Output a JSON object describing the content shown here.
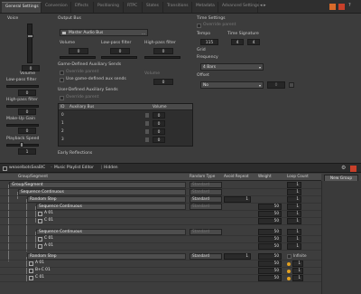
{
  "tabs": [
    "General Settings",
    "Conversion",
    "Effects",
    "Positioning",
    "RTPC",
    "States",
    "Transitions",
    "Metadata",
    "Advanced Settings"
  ],
  "voice": {
    "title": "Voice",
    "volume_label": "Volume",
    "volume_value": "0",
    "lowpass_label": "Low-pass filter",
    "lowpass_value": "0",
    "highpass_label": "High-pass filter",
    "highpass_value": "0",
    "makeup_label": "Make-Up Gain",
    "makeup_value": "0",
    "playback_label": "Playback Speed",
    "playback_value": "1"
  },
  "output_bus": {
    "title": "Output Bus",
    "bus_name": "Master Audio Bus",
    "volume_label": "Volume",
    "volume_value": "0",
    "lowpass_label": "Low-pass filter",
    "lowpass_value": "0",
    "highpass_label": "High-pass filter",
    "highpass_value": "0"
  },
  "game_sends": {
    "title": "Game-Defined Auxiliary Sends",
    "override_label": "Override parent",
    "volume_label": "Volume",
    "use_game_label": "Use game-defined aux sends",
    "value": "0"
  },
  "user_sends": {
    "title": "User-Defined Auxiliary Sends",
    "override_label": "Override parent",
    "headers": [
      "ID",
      "Auxiliary Bus",
      "Volume"
    ],
    "rows": [
      {
        "id": "0",
        "bus": "",
        "vol": "0"
      },
      {
        "id": "1",
        "bus": "",
        "vol": "0"
      },
      {
        "id": "2",
        "bus": "",
        "vol": "0"
      },
      {
        "id": "3",
        "bus": "",
        "vol": "0"
      }
    ]
  },
  "early_reflections": "Early Reflections",
  "time_settings": {
    "title": "Time Settings",
    "override_label": "Override parent",
    "tempo_label": "Tempo",
    "tempo_value": "115",
    "sig_label": "Time Signature",
    "sig_num": "4",
    "sig_den": "4",
    "grid_label": "Grid",
    "frequency_label": "Frequency",
    "frequency_value": "4 Bars",
    "offset_label": "Offset",
    "offset_value": "No",
    "offset_num": "0"
  },
  "editor": {
    "title": "Music Playlist Editor",
    "object": "weaselbotsSeaBlC",
    "state": "Hidden",
    "new_group": "New Group",
    "headers": [
      "Group/Segment",
      "Random Type",
      "Avoid Repeat",
      "Weight",
      "Loop Count"
    ],
    "rows": [
      {
        "label": "Group/Segment",
        "rnd": "Standard",
        "avoid": "",
        "weight": "",
        "loop": "1"
      },
      {
        "label": "Sequence Continuous",
        "rnd": "Standard",
        "avoid": "",
        "weight": "",
        "loop": "1"
      },
      {
        "label": "Random Step",
        "rnd": "Standard",
        "avoid": "1",
        "weight": "",
        "loop": "1"
      },
      {
        "label": "Sequence Continuous",
        "rnd": "Standard",
        "avoid": "",
        "weight": "50",
        "loop": "1"
      },
      {
        "label": "A 01",
        "rnd": "",
        "avoid": "",
        "weight": "50",
        "loop": "1"
      },
      {
        "label": "C 01",
        "rnd": "",
        "avoid": "",
        "weight": "50",
        "loop": "1"
      },
      {
        "label": "Sequence Continuous",
        "rnd": "Standard",
        "avoid": "",
        "weight": "50",
        "loop": "1"
      },
      {
        "label": "C 01",
        "rnd": "",
        "avoid": "",
        "weight": "50",
        "loop": "1"
      },
      {
        "label": "A 01",
        "rnd": "",
        "avoid": "",
        "weight": "50",
        "loop": "1"
      },
      {
        "label": "Random Step",
        "rnd": "Standard",
        "avoid": "1",
        "weight": "50",
        "loop": "Infinite"
      },
      {
        "label": "A 01",
        "rnd": "",
        "avoid": "",
        "weight": "50",
        "loop": "1"
      },
      {
        "label": "B+C 01",
        "rnd": "",
        "avoid": "",
        "weight": "50",
        "loop": "1"
      },
      {
        "label": "C 01",
        "rnd": "",
        "avoid": "",
        "weight": "50",
        "loop": "1"
      }
    ]
  }
}
